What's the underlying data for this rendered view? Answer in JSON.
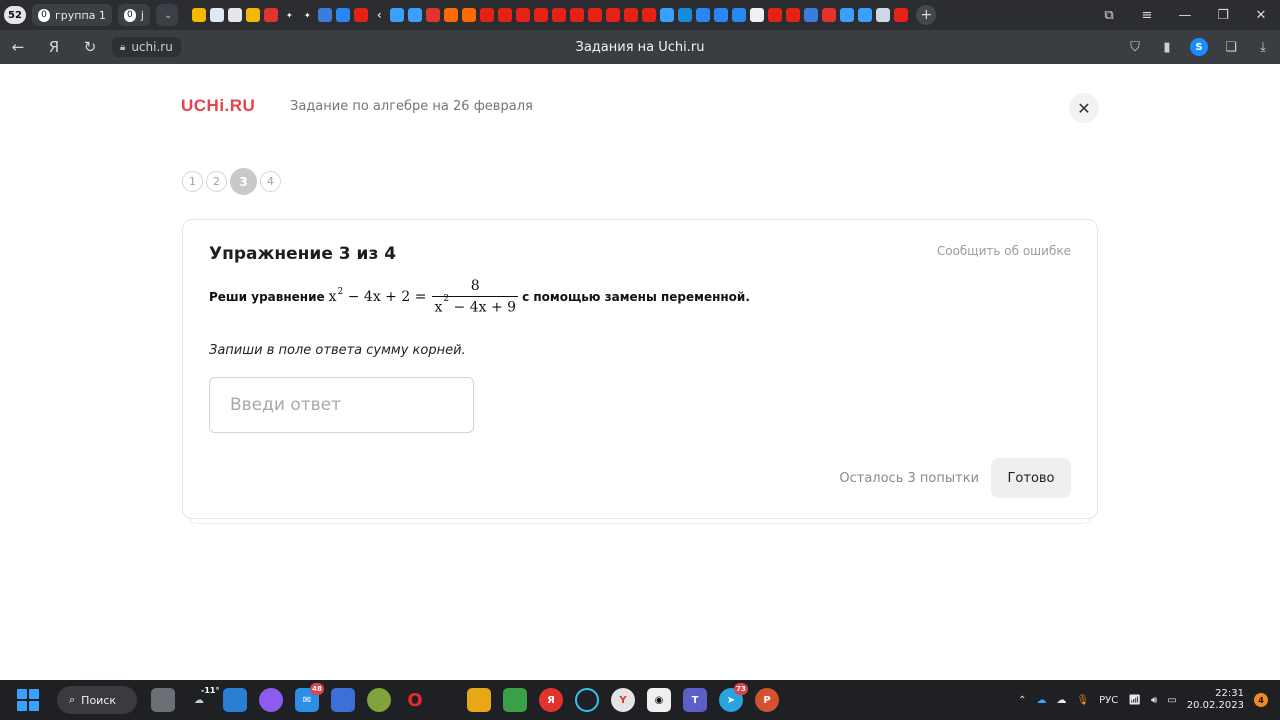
{
  "browser": {
    "tab_count": "52",
    "tab_groups": [
      {
        "count": "0",
        "label": "группа 1"
      },
      {
        "count": "0",
        "label": "j"
      }
    ],
    "url": "uchi.ru",
    "page_title": "Задания на Uchi.ru"
  },
  "header": {
    "logo": "UCHi.RU",
    "title": "Задание по алгебре на 26 февраля"
  },
  "steps": [
    {
      "label": "1",
      "active": false
    },
    {
      "label": "2",
      "active": false
    },
    {
      "label": "3",
      "active": true
    },
    {
      "label": "4",
      "active": false
    }
  ],
  "exercise": {
    "title": "Упражнение 3 из 4",
    "report_label": "Сообщить об ошибке",
    "task_prefix": "Реши уравнение",
    "equation_lhs": "x",
    "equation_lhs_exp": "2",
    "equation_lhs_rest": " − 4x + 2 =",
    "fraction_numerator": "8",
    "fraction_den_base": "x",
    "fraction_den_exp": "2",
    "fraction_den_rest": " − 4x + 9",
    "task_suffix": "с помощью замены переменной.",
    "instruction": "Запиши в поле ответа сумму корней.",
    "answer_placeholder": "Введи ответ",
    "attempts_text": "Осталось 3 попытки",
    "submit_label": "Готово"
  },
  "taskbar": {
    "search_label": "Поиск",
    "weather_temp": "-11°",
    "mail_badge": "48",
    "telegram_badge": "73",
    "language": "РУС",
    "time": "22:31",
    "date": "20.02.2023",
    "notifications": "4"
  }
}
